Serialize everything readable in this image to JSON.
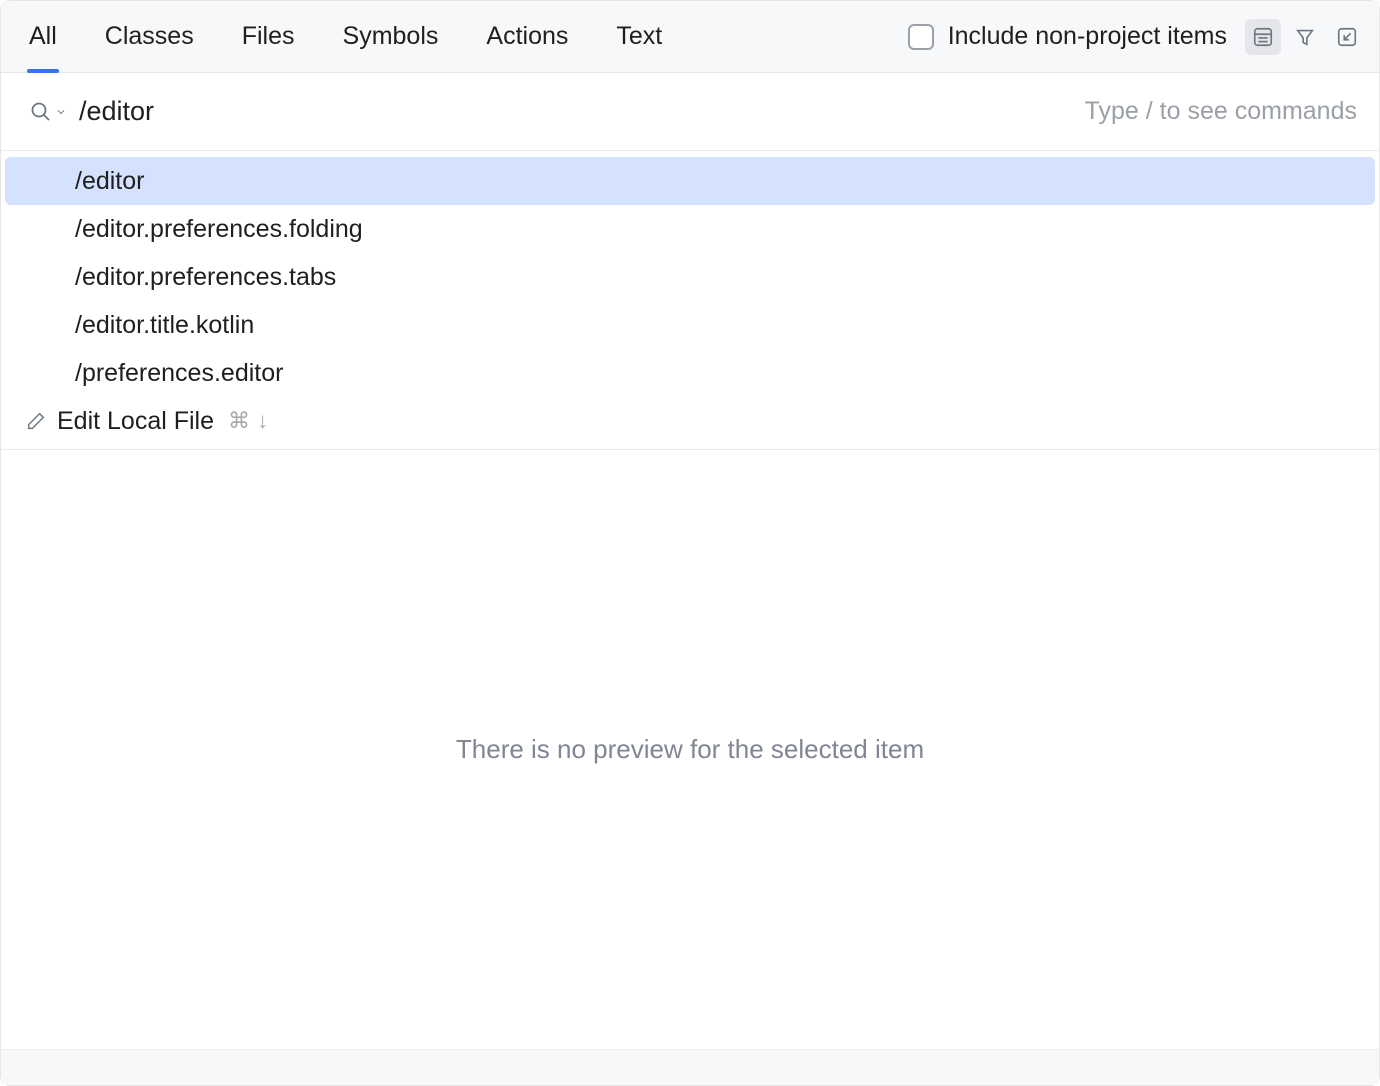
{
  "tabs": [
    "All",
    "Classes",
    "Files",
    "Symbols",
    "Actions",
    "Text"
  ],
  "activeTabIndex": 0,
  "includeNonProject": {
    "label": "Include non-project items",
    "checked": false
  },
  "search": {
    "value": "/editor",
    "hint": "Type / to see commands"
  },
  "results": [
    {
      "text": "/editor",
      "selected": true
    },
    {
      "text": "/editor.preferences.folding",
      "selected": false
    },
    {
      "text": "/editor.preferences.tabs",
      "selected": false
    },
    {
      "text": "/editor.title.kotlin",
      "selected": false
    },
    {
      "text": "/preferences.editor",
      "selected": false
    }
  ],
  "action": {
    "label": "Edit Local File",
    "shortcut": "⌘ ↓"
  },
  "preview": {
    "message": "There is no preview for the selected item"
  }
}
